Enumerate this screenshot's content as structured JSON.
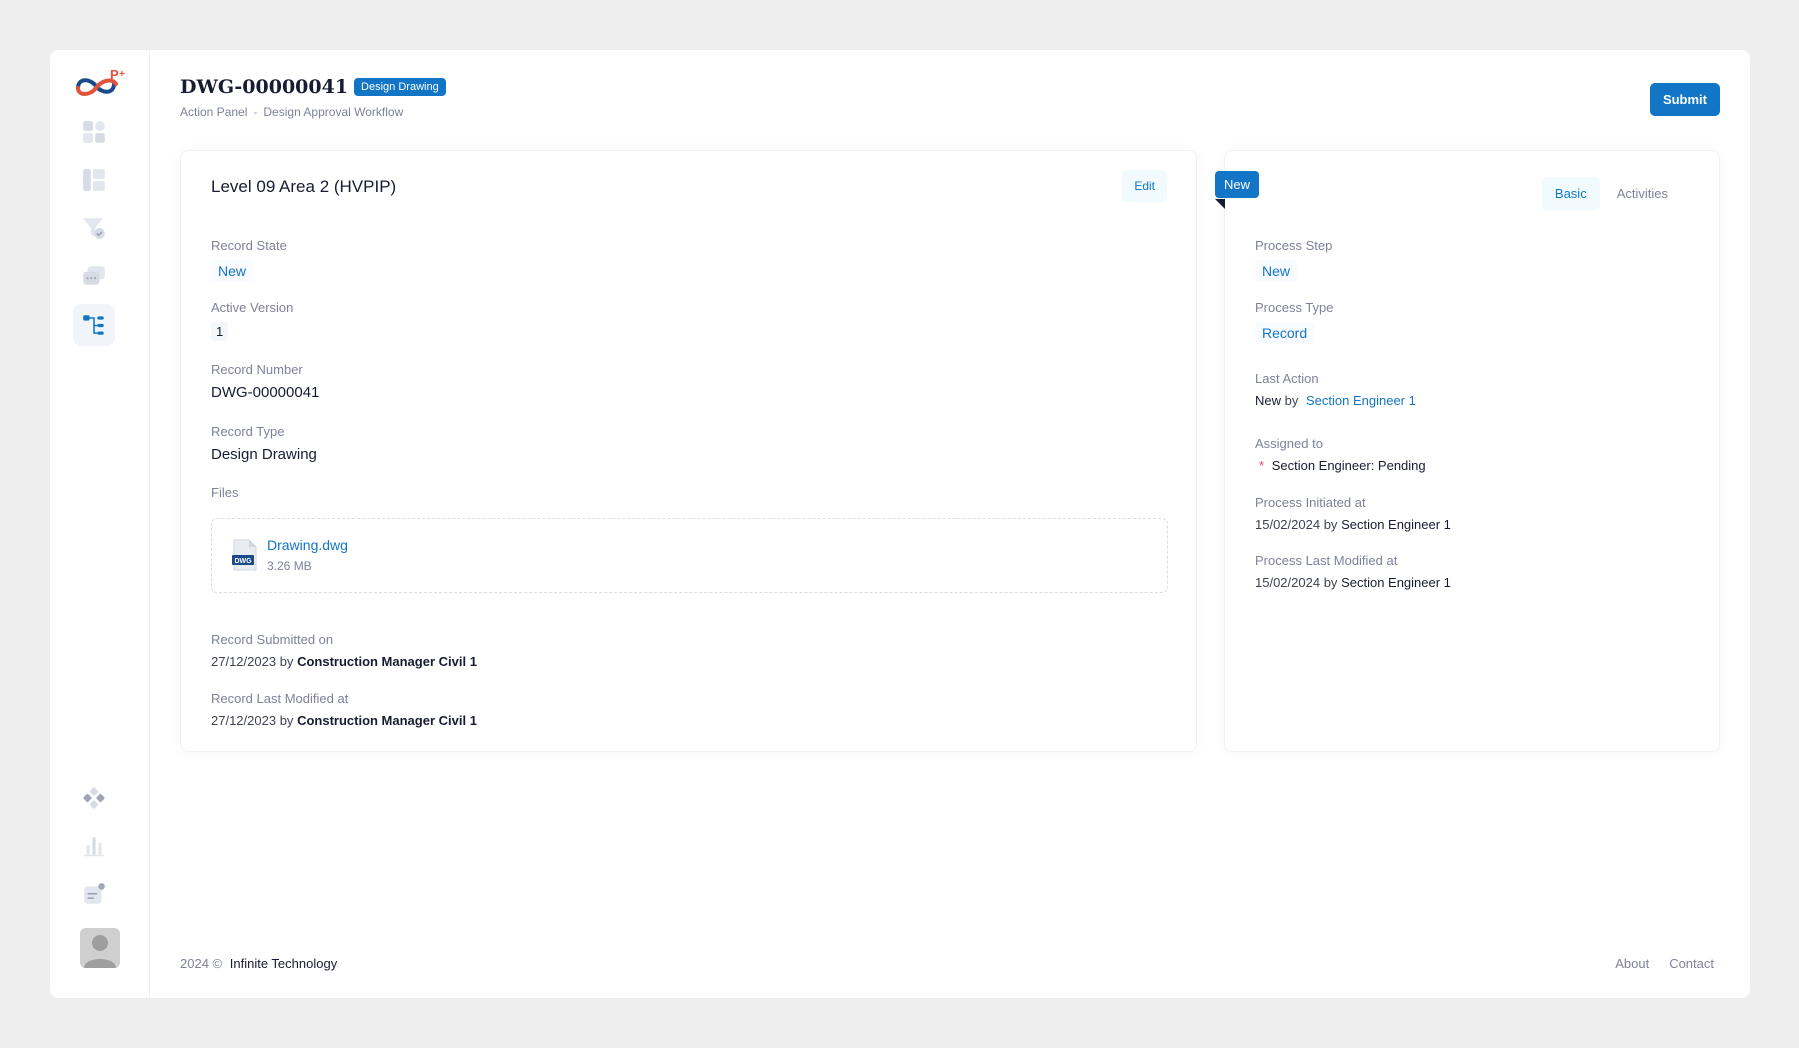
{
  "header": {
    "record_id": "DWG-00000041",
    "type_badge": "Design Drawing",
    "breadcrumb": [
      "Action Panel",
      "Design Approval Workflow"
    ],
    "breadcrumb_separator": "-",
    "submit_label": "Submit"
  },
  "sidebar": {
    "items": [
      {
        "icon": "dashboard-icon"
      },
      {
        "icon": "layout-icon"
      },
      {
        "icon": "filter-check-icon"
      },
      {
        "icon": "chat-icon"
      },
      {
        "icon": "workflow-tree-icon",
        "active": true
      }
    ],
    "bottom_items": [
      {
        "icon": "apps-icon"
      },
      {
        "icon": "bar-chart-icon"
      },
      {
        "icon": "notification-icon"
      }
    ]
  },
  "record_card": {
    "title": "Level 09 Area 2 (HVPIP)",
    "edit_label": "Edit",
    "record_state_label": "Record State",
    "record_state_value": "New",
    "active_version_label": "Active Version",
    "active_version_value": "1",
    "record_number_label": "Record Number",
    "record_number_value": "DWG-00000041",
    "record_type_label": "Record Type",
    "record_type_value": "Design Drawing",
    "files_label": "Files",
    "files": [
      {
        "name": "Drawing.dwg",
        "size": "3.26 MB",
        "icon_text": "DWG"
      }
    ],
    "submitted_label": "Record Submitted on",
    "submitted_date": "27/12/2023",
    "submitted_by_word": "by",
    "submitted_by": "Construction Manager Civil 1",
    "modified_label": "Record Last Modified at",
    "modified_date": "27/12/2023",
    "modified_by_word": "by",
    "modified_by": "Construction Manager Civil 1"
  },
  "process_card": {
    "ribbon": "New",
    "tabs": [
      {
        "label": "Basic",
        "active": true
      },
      {
        "label": "Activities",
        "active": false
      }
    ],
    "process_step_label": "Process Step",
    "process_step_value": "New",
    "process_type_label": "Process Type",
    "process_type_value": "Record",
    "last_action_label": "Last Action",
    "last_action_value": "New",
    "last_action_by_word": "by",
    "last_action_by": "Section Engineer 1",
    "assigned_label": "Assigned to",
    "assigned_marker": "*",
    "assigned_value": "Section Engineer: Pending",
    "initiated_label": "Process Initiated at",
    "initiated_date": "15/02/2024",
    "initiated_by_word": "by",
    "initiated_by": "Section Engineer 1",
    "process_modified_label": "Process Last Modified at",
    "process_modified_date": "15/02/2024",
    "process_modified_by_word": "by",
    "process_modified_by": "Section Engineer 1"
  },
  "footer": {
    "year": "2024 ©",
    "brand": "Infinite Technology",
    "links": [
      "About",
      "Contact"
    ]
  },
  "colors": {
    "primary": "#1275c6",
    "background": "#eeeeee",
    "text": "#181c32",
    "muted": "#7e8299",
    "required": "#f1416c"
  }
}
